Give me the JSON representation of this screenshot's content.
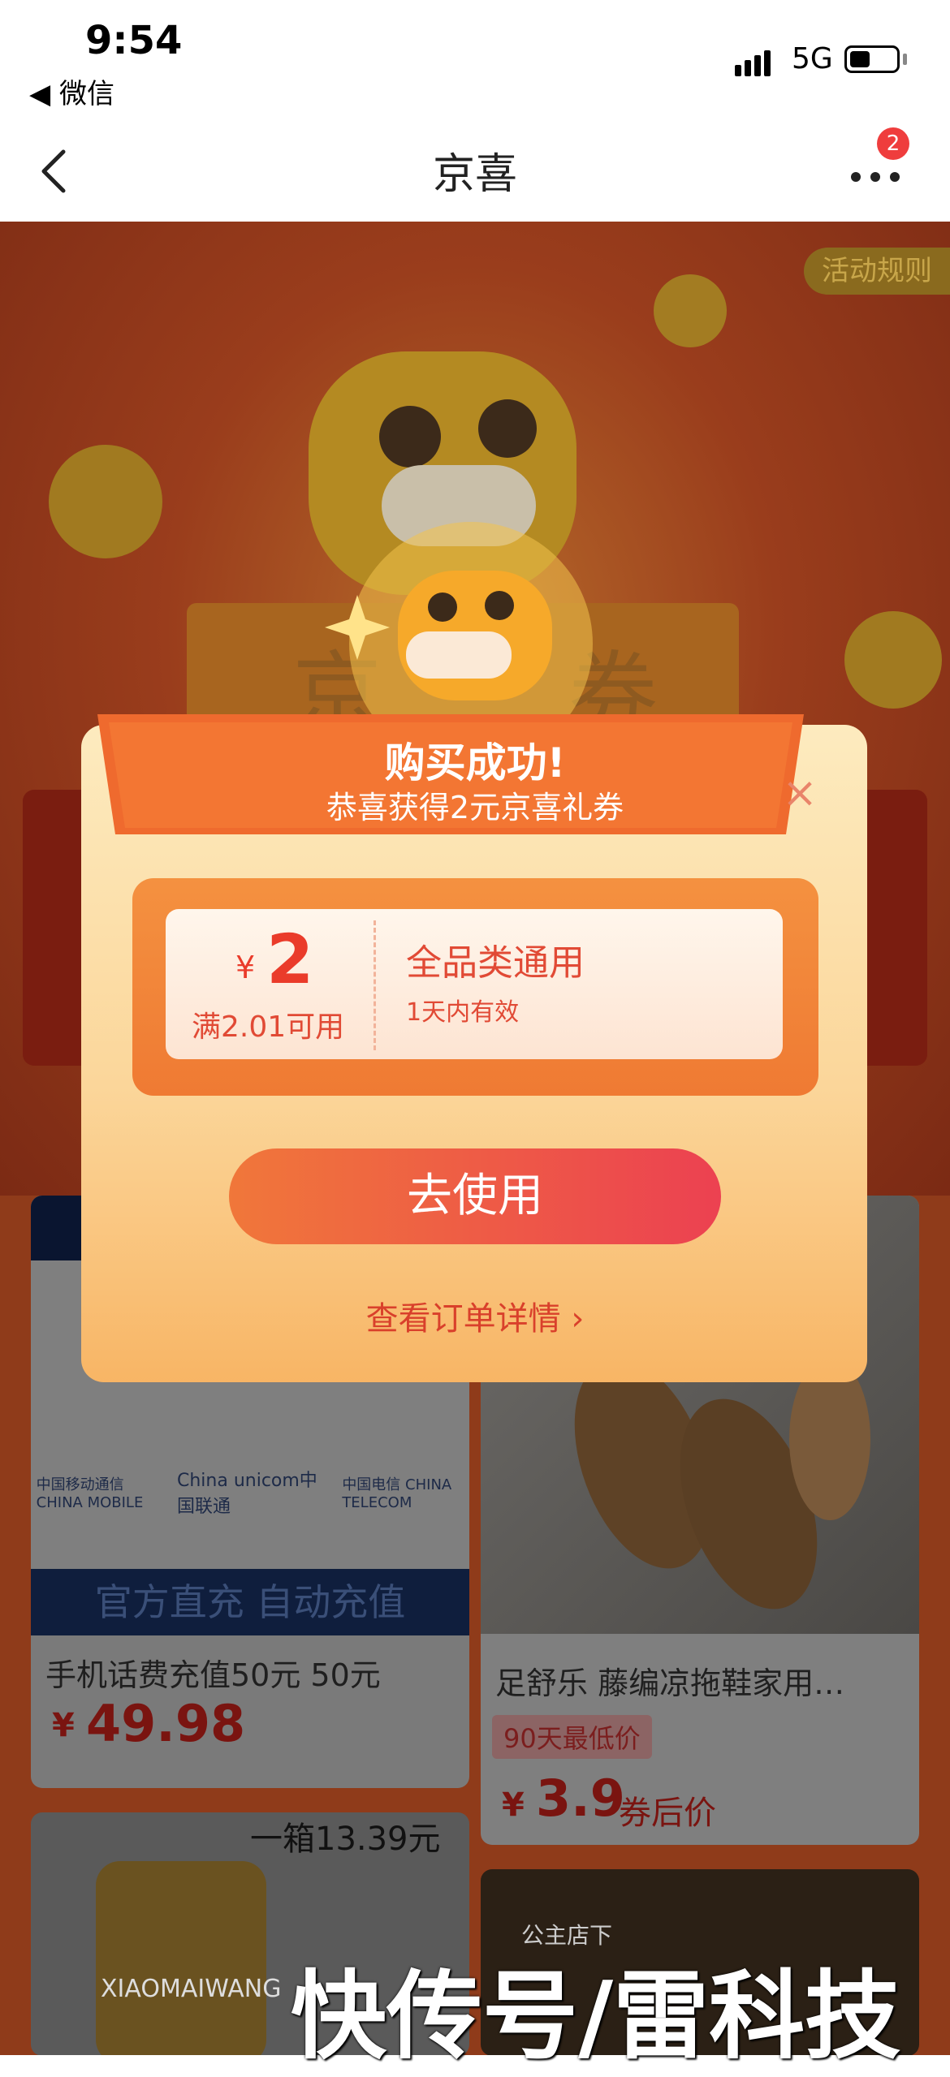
{
  "status_bar": {
    "time": "9:54",
    "back_app": "◀ 微信",
    "network": "5G"
  },
  "nav": {
    "title": "京喜",
    "badge_count": "2"
  },
  "background": {
    "rules_label": "活动规则",
    "card1": {
      "official_text": "官方直充 自动充值",
      "title": "手机话费充值50元 50元",
      "currency": "¥",
      "price": "49.98",
      "carriers": [
        "中国移动通信 CHINA MOBILE",
        "China unicom中国联通",
        "中国电信 CHINA TELECOM"
      ]
    },
    "card2": {
      "title": "足舒乐 藤编凉拖鞋家用…",
      "tag": "90天最低价",
      "currency": "¥",
      "price": "3.9",
      "price_suffix": "券后价"
    },
    "card3": {
      "promo": "一箱13.39元",
      "brand": "XIAOMAIWANG"
    },
    "card4": {
      "brand": "公主店下"
    }
  },
  "modal": {
    "title": "购买成功!",
    "subtitle": "恭喜获得2元京喜礼券",
    "close": "×",
    "coupon": {
      "currency": "¥",
      "amount": "2",
      "condition": "满2.01可用",
      "scope": "全品类通用",
      "validity": "1天内有效"
    },
    "use_button": "去使用",
    "detail_link": "查看订单详情 ›"
  },
  "watermark": "快传号/雷科技",
  "colors": {
    "accent": "#ea3b2a",
    "button_start": "#f0773a",
    "button_end": "#ec4151",
    "modal_top": "#fdebbf",
    "modal_bottom": "#f8b565"
  }
}
